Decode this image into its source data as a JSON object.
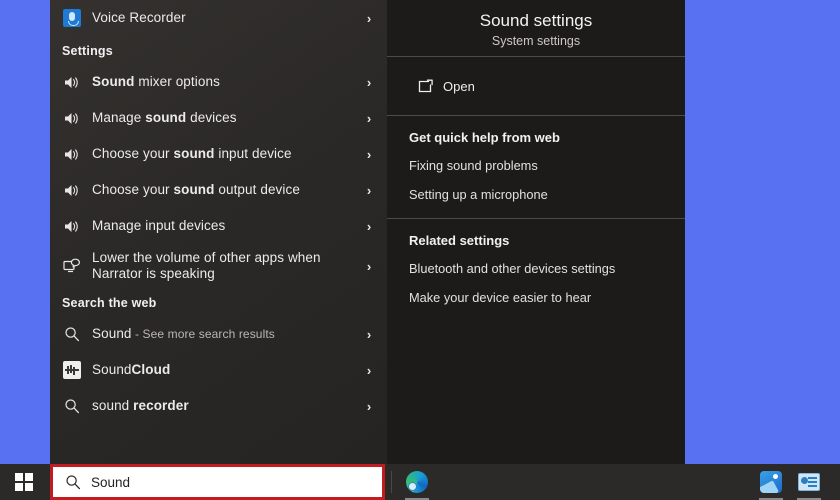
{
  "desktop": {
    "background_color": "#5870f2"
  },
  "results_pane": {
    "top_result": {
      "label": "Voice Recorder",
      "icon": "voice-recorder-icon",
      "chevron": "›"
    },
    "sections": [
      {
        "heading": "Settings",
        "items": [
          {
            "pre": "",
            "bold": "Sound",
            "post": " mixer options",
            "icon": "speaker-icon",
            "chevron": "›"
          },
          {
            "pre": "Manage ",
            "bold": "sound",
            "post": " devices",
            "icon": "speaker-icon",
            "chevron": "›"
          },
          {
            "pre": "Choose your ",
            "bold": "sound",
            "post": " input device",
            "icon": "speaker-icon",
            "chevron": "›"
          },
          {
            "pre": "Choose your ",
            "bold": "sound",
            "post": " output device",
            "icon": "speaker-icon",
            "chevron": "›"
          },
          {
            "pre": "Manage input devices",
            "bold": "",
            "post": "",
            "icon": "speaker-icon",
            "chevron": "›"
          },
          {
            "pre": "Lower the volume of other apps when Narrator is speaking",
            "bold": "",
            "post": "",
            "icon": "narrator-icon",
            "chevron": "›"
          }
        ]
      },
      {
        "heading": "Search the web",
        "items": [
          {
            "pre": "",
            "bold": "Sound",
            "post": "",
            "suffix": " - See more search results",
            "icon": "search-icon",
            "chevron": "›"
          },
          {
            "pre": "Sound",
            "bold": "Cloud",
            "post": "",
            "icon": "soundcloud-icon",
            "chevron": "›"
          },
          {
            "pre": "sound ",
            "bold": "recorder",
            "post": "",
            "icon": "search-icon",
            "chevron": "›"
          }
        ]
      }
    ]
  },
  "detail_pane": {
    "title": "Sound settings",
    "subtitle": "System settings",
    "open_action": {
      "label": "Open",
      "icon": "open-external-icon"
    },
    "quick_help": {
      "heading": "Get quick help from web",
      "links": [
        "Fixing sound problems",
        "Setting up a microphone"
      ]
    },
    "related": {
      "heading": "Related settings",
      "links": [
        "Bluetooth and other devices settings",
        "Make your device easier to hear"
      ]
    }
  },
  "taskbar": {
    "start_button": "windows-logo-icon",
    "search": {
      "value": "Sound",
      "placeholder": "Type here to search",
      "icon": "search-icon",
      "highlight_color": "#c21b20"
    },
    "pinned": [
      {
        "name": "microsoft-edge",
        "icon": "edge-icon"
      }
    ],
    "tray": [
      {
        "name": "photos",
        "icon": "photos-icon"
      },
      {
        "name": "store-app",
        "icon": "store-icon"
      }
    ]
  }
}
